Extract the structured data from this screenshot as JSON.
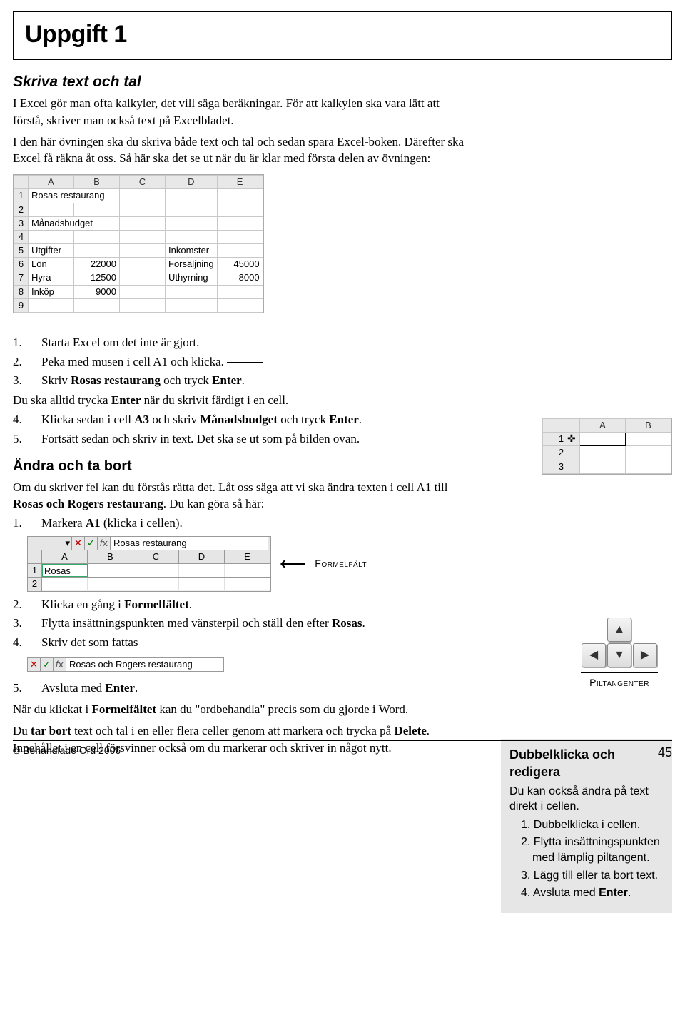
{
  "title": "Uppgift 1",
  "h2a": "Skriva text och tal",
  "p1": "I Excel gör man ofta kalkyler, det vill säga beräkningar. För att kalkylen ska vara lätt att förstå, skriver man också text på Excelbladet.",
  "p2": "I den här övningen ska du skriva både text och tal och sedan spara Excel-boken. Därefter ska Excel få räkna åt oss. Så här ska det se ut när du är klar med första delen av övningen:",
  "table1": {
    "cols": [
      "A",
      "B",
      "C",
      "D",
      "E"
    ],
    "rows": [
      [
        "1",
        "Rosas restaurang",
        "",
        "",
        "",
        ""
      ],
      [
        "2",
        "",
        "",
        "",
        "",
        ""
      ],
      [
        "3",
        "Månadsbudget",
        "",
        "",
        "",
        ""
      ],
      [
        "4",
        "",
        "",
        "",
        "",
        ""
      ],
      [
        "5",
        "Utgifter",
        "",
        "",
        "Inkomster",
        ""
      ],
      [
        "6",
        "Lön",
        "22000",
        "",
        "Försäljning",
        "45000"
      ],
      [
        "7",
        "Hyra",
        "12500",
        "",
        "Uthyrning",
        "8000"
      ],
      [
        "8",
        "Inköp",
        "9000",
        "",
        "",
        ""
      ],
      [
        "9",
        "",
        "",
        "",
        "",
        ""
      ]
    ]
  },
  "steps1": [
    "Starta Excel om det inte är gjort.",
    "Peka med musen i cell A1 och klicka.",
    "Skriv Rosas restaurang och tryck Enter."
  ],
  "mid1": "Du ska alltid trycka Enter när du skrivit färdigt i en cell.",
  "steps1b": [
    "Klicka sedan i cell A3 och skriv Månadsbudget och tryck Enter.",
    "Fortsätt sedan och skriv in text. Det ska se ut som på bilden ovan."
  ],
  "h3a": "Ändra och ta bort",
  "p3": "Om du skriver fel kan du förstås rätta det. Låt oss säga att vi ska ändra texten i cell A1 till Rosas och Rogers restaurang. Du kan göra så här:",
  "steps2a": [
    "Markera A1 (klicka i cellen)."
  ],
  "formula_text": "Rosas restaurang",
  "formula_cols": [
    "A",
    "B",
    "C",
    "D",
    "E"
  ],
  "formula_fill": "Rosas rest",
  "formelfalt": "Formelfält",
  "piltangenter": "Piltangenter",
  "steps2b": [
    "Klicka en gång i Formelfältet.",
    "Flytta insättningspunkten med vänsterpil och ställ den efter Rosas.",
    "Skriv det som fattas"
  ],
  "formula2_text": "Rosas och Rogers restaurang",
  "steps2c": [
    "Avsluta med Enter."
  ],
  "p4a": "När du klickat i Formelfältet kan du \"ordbehandla\" precis som du gjorde i Word.",
  "p4b": "Du tar bort text och tal i en eller flera celler genom att markera och trycka på Delete. Innehållet i en cell försvinner också om du markerar och skriver in något nytt.",
  "side": {
    "title": "Dubbelklicka och redigera",
    "lead": "Du kan också ändra på text direkt i cellen.",
    "items": [
      "Dubbelklicka i cellen.",
      "Flytta insättningspunkten med lämplig piltangent.",
      "Lägg till eller ta bort text.",
      "Avsluta med Enter."
    ]
  },
  "mini_cols": [
    "A",
    "B"
  ],
  "footer_left": "© Behandlade Ord 2006",
  "footer_right": "45"
}
